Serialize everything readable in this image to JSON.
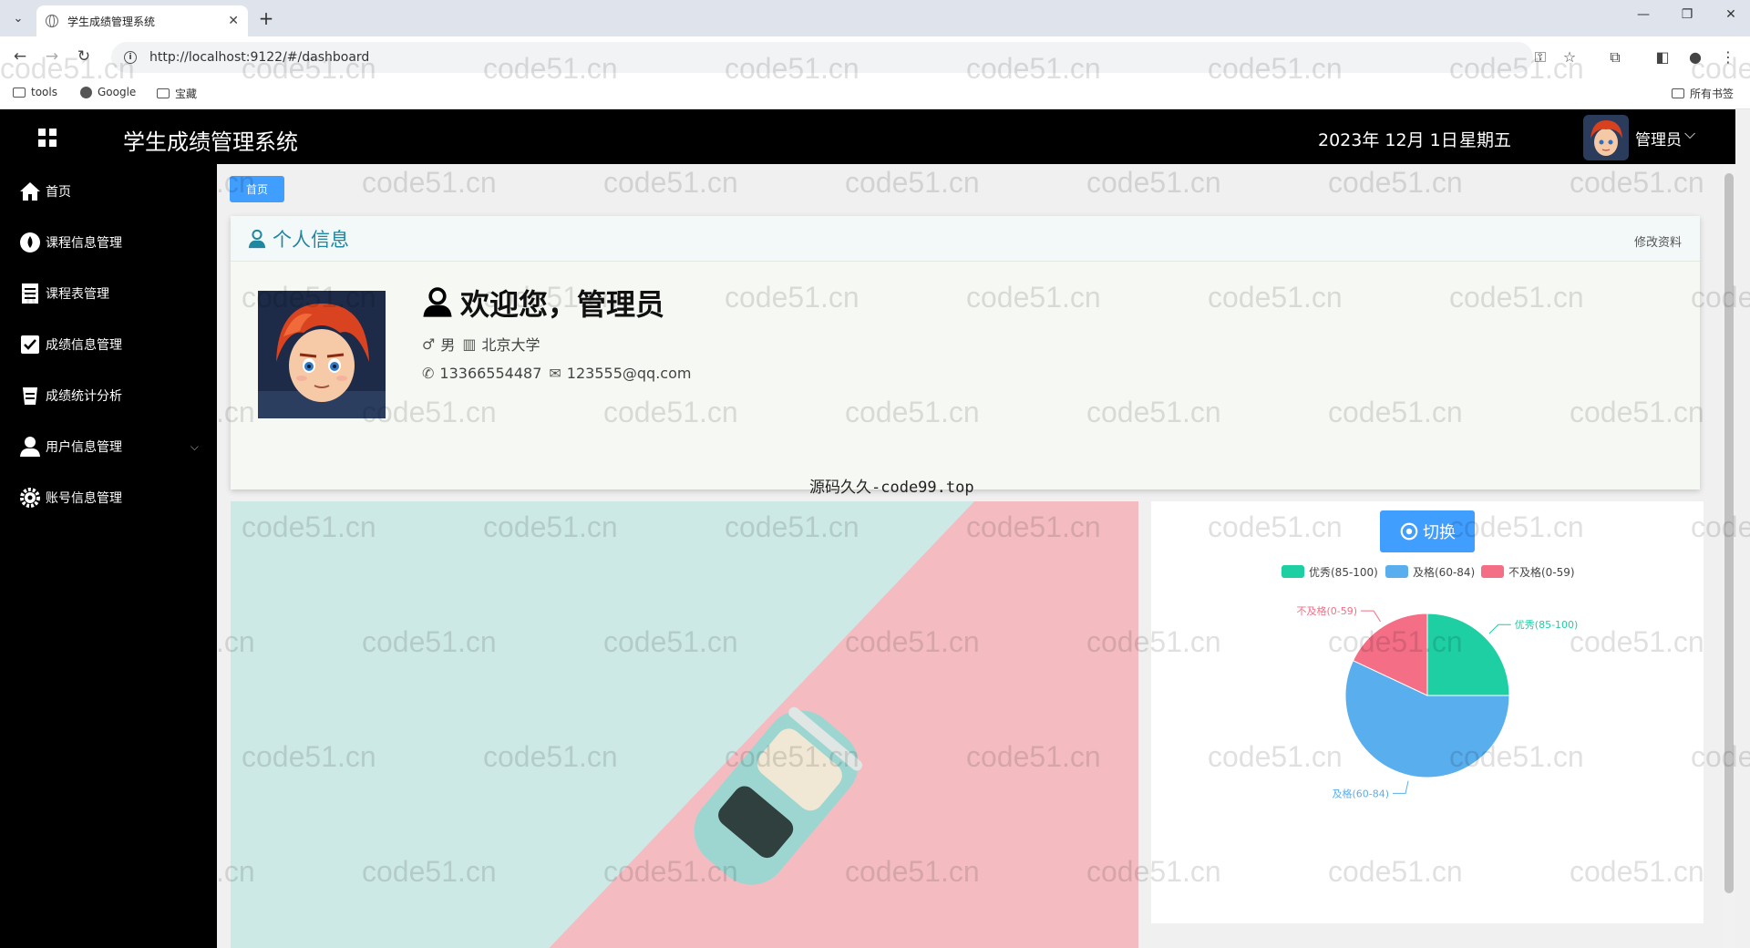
{
  "browser": {
    "tab_title": "学生成绩管理系统",
    "url": "http://localhost:9122/#/dashboard",
    "bookmarks": [
      "tools",
      "Google",
      "宝藏"
    ],
    "all_bookmarks": "所有书签"
  },
  "header": {
    "title": "学生成绩管理系统",
    "date": "2023年 12月 1日",
    "weekday": "星期五",
    "user": "管理员"
  },
  "sidebar": {
    "items": [
      {
        "label": "首页",
        "icon": "home-icon"
      },
      {
        "label": "课程信息管理",
        "icon": "drop-icon"
      },
      {
        "label": "课程表管理",
        "icon": "document-icon"
      },
      {
        "label": "成绩信息管理",
        "icon": "checkbox-icon"
      },
      {
        "label": "成绩统计分析",
        "icon": "cup-icon"
      },
      {
        "label": "用户信息管理",
        "icon": "user-icon"
      },
      {
        "label": "账号信息管理",
        "icon": "gear-icon"
      }
    ]
  },
  "breadcrumb": {
    "home": "首页"
  },
  "profile": {
    "card_title": "个人信息",
    "edit_label": "修改资料",
    "welcome": "欢迎您，管理员",
    "gender": "男",
    "school": "北京大学",
    "phone": "13366554487",
    "email": "123555@qq.com",
    "source_note": "源码久久-code99.top"
  },
  "chart_panel": {
    "switch_label": "切换"
  },
  "chart_data": {
    "type": "pie",
    "categories": [
      "优秀(85-100)",
      "及格(60-84)",
      "不及格(0-59)"
    ],
    "values": [
      25,
      57,
      18
    ],
    "colors": [
      "#1ecfa4",
      "#59aeee",
      "#f46e86"
    ],
    "legend_position": "top"
  },
  "watermark": "code51.cn"
}
